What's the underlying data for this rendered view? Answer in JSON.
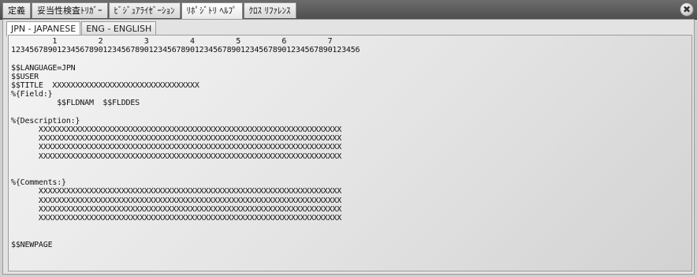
{
  "tabs": [
    {
      "label": "定義"
    },
    {
      "label": "妥当性検査ﾄﾘｶﾞｰ"
    },
    {
      "label": "ﾋﾞｼﾞｭｱﾗｲｾﾞｰｼｮﾝ"
    },
    {
      "label": "ﾘﾎﾟｼﾞﾄﾘ ﾍﾙﾌﾟ"
    },
    {
      "label": "ｸﾛｽ ﾘﾌｧﾚﾝｽ"
    }
  ],
  "close_icon": "✖",
  "language_tabs": [
    {
      "label": "JPN - JAPANESE"
    },
    {
      "label": "ENG - ENGLISH"
    }
  ],
  "editor_lines": [
    "         1         2         3         4         5         6         7",
    "1234567890123456789012345678901234567890123456789012345678901234567890123456",
    "",
    "$$LANGUAGE=JPN",
    "$$USER",
    "$$TITLE  XXXXXXXXXXXXXXXXXXXXXXXXXXXXXXXX",
    "%{Field:}",
    "          $$FLDNAM  $$FLDDES",
    "",
    "%{Description:}",
    "      XXXXXXXXXXXXXXXXXXXXXXXXXXXXXXXXXXXXXXXXXXXXXXXXXXXXXXXXXXXXXXXXXX",
    "      XXXXXXXXXXXXXXXXXXXXXXXXXXXXXXXXXXXXXXXXXXXXXXXXXXXXXXXXXXXXXXXXXX",
    "      XXXXXXXXXXXXXXXXXXXXXXXXXXXXXXXXXXXXXXXXXXXXXXXXXXXXXXXXXXXXXXXXXX",
    "      XXXXXXXXXXXXXXXXXXXXXXXXXXXXXXXXXXXXXXXXXXXXXXXXXXXXXXXXXXXXXXXXXX",
    "",
    "",
    "%{Comments:}",
    "      XXXXXXXXXXXXXXXXXXXXXXXXXXXXXXXXXXXXXXXXXXXXXXXXXXXXXXXXXXXXXXXXXX",
    "      XXXXXXXXXXXXXXXXXXXXXXXXXXXXXXXXXXXXXXXXXXXXXXXXXXXXXXXXXXXXXXXXXX",
    "      XXXXXXXXXXXXXXXXXXXXXXXXXXXXXXXXXXXXXXXXXXXXXXXXXXXXXXXXXXXXXXXXXX",
    "      XXXXXXXXXXXXXXXXXXXXXXXXXXXXXXXXXXXXXXXXXXXXXXXXXXXXXXXXXXXXXXXXXX",
    "",
    "",
    "$$NEWPAGE"
  ]
}
